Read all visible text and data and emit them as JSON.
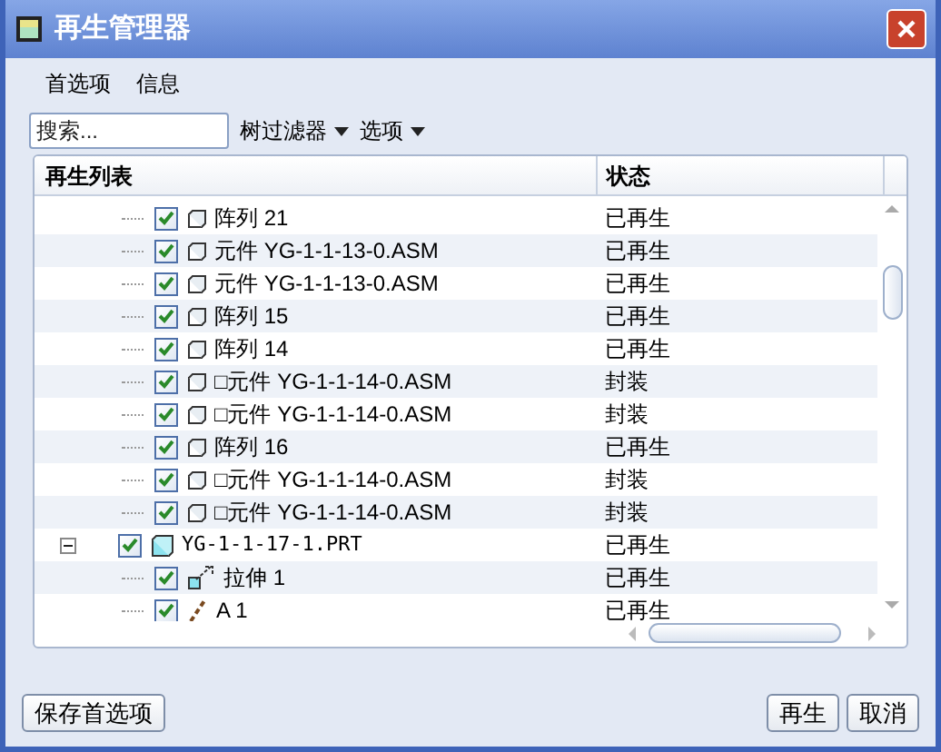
{
  "window": {
    "title": "再生管理器"
  },
  "menu": [
    "首选项",
    "信息"
  ],
  "toolbar": {
    "search": {
      "placeholder": "搜索..."
    },
    "dropdowns": [
      "树过滤器",
      "选项"
    ]
  },
  "table": {
    "columns": [
      "再生列表",
      "状态"
    ],
    "tree": [
      {
        "children": [
          {
            "label": "阵列 21",
            "kind": "feature",
            "checked": true,
            "status": "已再生"
          },
          {
            "label": "元件 YG-1-1-13-0.ASM",
            "kind": "feature",
            "checked": true,
            "status": "已再生"
          },
          {
            "label": "元件 YG-1-1-13-0.ASM",
            "kind": "feature",
            "checked": true,
            "status": "已再生"
          },
          {
            "label": "阵列 15",
            "kind": "feature",
            "checked": true,
            "status": "已再生"
          },
          {
            "label": "阵列 14",
            "kind": "feature",
            "checked": true,
            "status": "已再生"
          },
          {
            "label": "□元件 YG-1-1-14-0.ASM",
            "kind": "feature",
            "checked": true,
            "status": "封装"
          },
          {
            "label": "□元件 YG-1-1-14-0.ASM",
            "kind": "feature",
            "checked": true,
            "status": "封装"
          },
          {
            "label": "阵列 16",
            "kind": "feature",
            "checked": true,
            "status": "已再生"
          },
          {
            "label": "□元件 YG-1-1-14-0.ASM",
            "kind": "feature",
            "checked": true,
            "status": "封装"
          },
          {
            "label": "□元件 YG-1-1-14-0.ASM",
            "kind": "feature",
            "checked": true,
            "status": "封装"
          }
        ]
      },
      {
        "label": "YG-1-1-17-1.PRT",
        "kind": "part",
        "checked": true,
        "expanded": true,
        "status": "已再生",
        "children": [
          {
            "label": "拉伸 1",
            "kind": "extrude",
            "checked": true,
            "status": "已再生"
          },
          {
            "label": "A 1",
            "kind": "axis",
            "checked": true,
            "status": "已再生"
          }
        ]
      }
    ]
  },
  "buttons": {
    "left": "保存首选项",
    "right": [
      "再生",
      "取消"
    ]
  }
}
